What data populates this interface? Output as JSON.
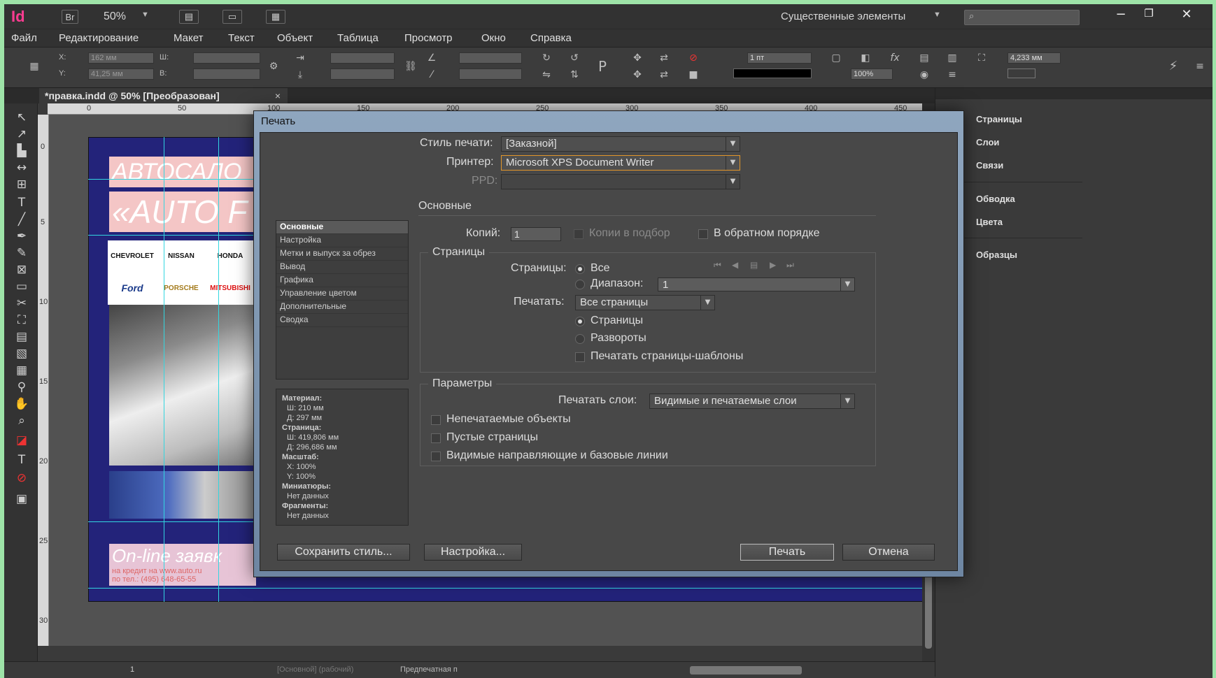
{
  "app": {
    "logo": "Id",
    "bridge": "Br",
    "zoom": "50%",
    "workspace": "Существенные элементы"
  },
  "menu": [
    "Файл",
    "Редактирование",
    "Макет",
    "Текст",
    "Объект",
    "Таблица",
    "Просмотр",
    "Окно",
    "Справка"
  ],
  "control": {
    "x_label": "X:",
    "x_value": "162 мм",
    "y_label": "Y:",
    "y_value": "41,25 мм",
    "w_label": "Ш:",
    "h_label": "В:",
    "stroke_weight": "1 пт",
    "opacity": "100%",
    "offset": "4,233 мм"
  },
  "document": {
    "tab_title": "*правка.indd @ 50% [Преобразован]",
    "close": "×",
    "ruler_h": [
      "0",
      "50",
      "100",
      "150",
      "200",
      "250",
      "300",
      "350",
      "400",
      "450"
    ],
    "ruler_v": [
      "0",
      "5",
      "10",
      "15",
      "20",
      "25",
      "30"
    ]
  },
  "artwork": {
    "headline1": "АВТОСАЛО",
    "headline2": "«AUTO F",
    "logos": [
      "CHEVROLET",
      "NISSAN",
      "HONDA",
      "Ford",
      "PORSCHE",
      "MITSUBISHI"
    ],
    "footer_title": "On-line заявк",
    "footer_line1": "на кредит на www.auto.ru",
    "footer_line2": "по тел.: (495) 648-65-55"
  },
  "panels": {
    "items": [
      {
        "icon": "pages-icon",
        "label": "Страницы"
      },
      {
        "icon": "layers-icon",
        "label": "Слои"
      },
      {
        "icon": "links-icon",
        "label": "Связи"
      },
      {
        "icon": "stroke-icon",
        "label": "Обводка"
      },
      {
        "icon": "color-icon",
        "label": "Цвета"
      },
      {
        "icon": "swatches-icon",
        "label": "Образцы"
      }
    ]
  },
  "dialog": {
    "title": "Печать",
    "print_style_label": "Стиль печати:",
    "print_style_value": "[Заказной]",
    "printer_label": "Принтер:",
    "printer_value": "Microsoft XPS Document Writer",
    "ppd_label": "PPD:",
    "nav": [
      "Основные",
      "Настройка",
      "Метки и выпуск за обрез",
      "Вывод",
      "Графика",
      "Управление цветом",
      "Дополнительные",
      "Сводка"
    ],
    "section_title": "Основные",
    "copies_label": "Копий:",
    "copies_value": "1",
    "collate_label": "Копии в подбор",
    "reverse_label": "В обратном порядке",
    "pages_group": "Страницы",
    "pages_label": "Страницы:",
    "pages_all": "Все",
    "range_label": "Диапазон:",
    "range_value": "1",
    "print_label": "Печатать:",
    "print_value": "Все страницы",
    "opt_pages": "Страницы",
    "opt_spreads": "Развороты",
    "opt_master": "Печатать страницы-шаблоны",
    "params_group": "Параметры",
    "layers_label": "Печатать слои:",
    "layers_value": "Видимые и печатаемые слои",
    "nonprint": "Непечатаемые объекты",
    "blank": "Пустые страницы",
    "guides": "Видимые направляющие и базовые линии",
    "summary": [
      {
        "t": "Материал:",
        "b": true
      },
      {
        "t": "Ш: 210 мм"
      },
      {
        "t": "Д: 297 мм"
      },
      {
        "t": "Страница:",
        "b": true
      },
      {
        "t": "Ш: 419,806 мм"
      },
      {
        "t": "Д: 296,686 мм"
      },
      {
        "t": "Масштаб:",
        "b": true
      },
      {
        "t": "X: 100%"
      },
      {
        "t": "Y: 100%"
      },
      {
        "t": "Миниатюры:",
        "b": true
      },
      {
        "t": "Нет данных"
      },
      {
        "t": "Фрагменты:",
        "b": true
      },
      {
        "t": "Нет данных"
      }
    ],
    "btn_save_style": "Сохранить стиль...",
    "btn_setup": "Настройка...",
    "btn_print": "Печать",
    "btn_cancel": "Отмена"
  },
  "status": {
    "page": "1",
    "master": "[Основной] (рабочий)",
    "preflight": "Предпечатная п"
  }
}
